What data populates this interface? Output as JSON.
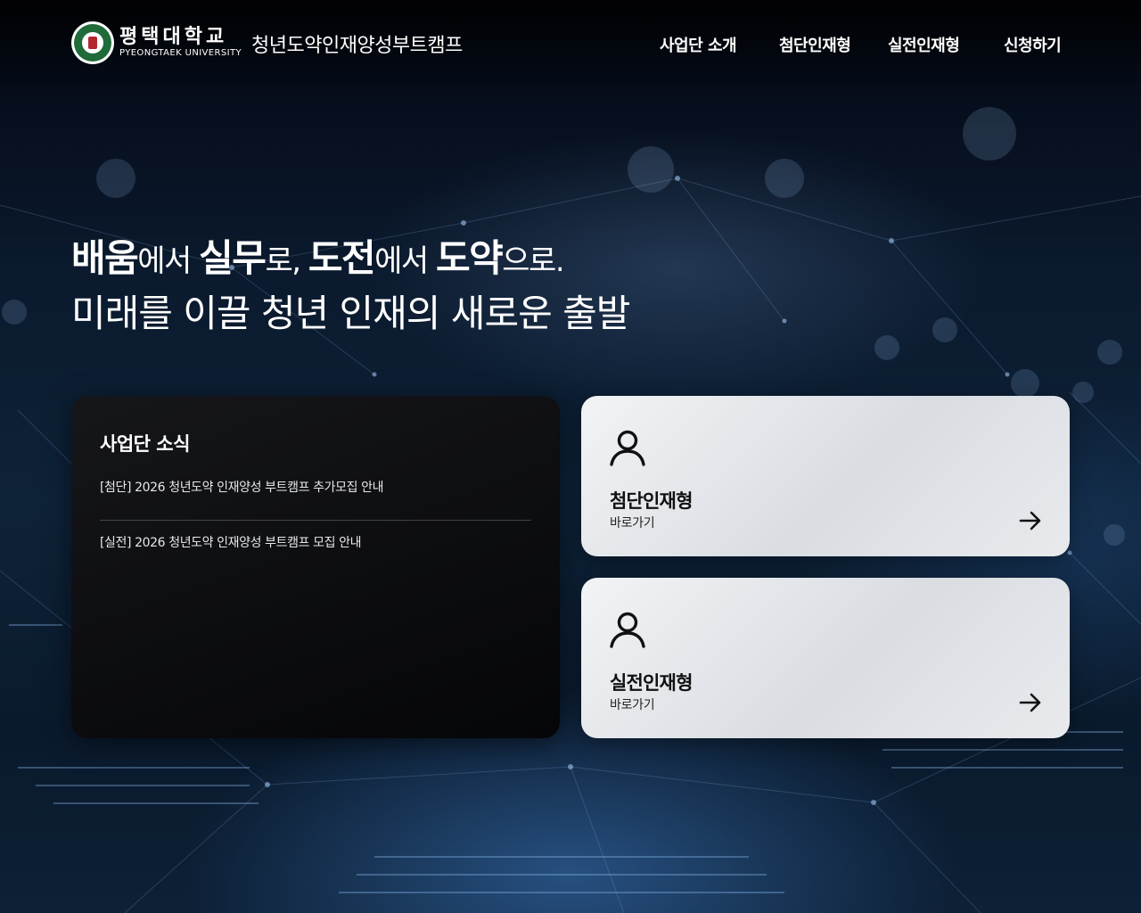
{
  "header": {
    "logo_ko": "평택대학교",
    "logo_en": "PYEONGTAEK UNIVERSITY",
    "site_title": "청년도약인재양성부트캠프",
    "nav": [
      {
        "label": "사업단 소개"
      },
      {
        "label": "첨단인재형"
      },
      {
        "label": "실전인재형"
      },
      {
        "label": "신청하기"
      }
    ]
  },
  "hero": {
    "line1": [
      {
        "text": "배움",
        "style": "b"
      },
      {
        "text": "에서 ",
        "style": "l"
      },
      {
        "text": "실무",
        "style": "b"
      },
      {
        "text": "로, ",
        "style": "l"
      },
      {
        "text": "도전",
        "style": "b"
      },
      {
        "text": "에서 ",
        "style": "l"
      },
      {
        "text": "도약",
        "style": "b"
      },
      {
        "text": "으로.",
        "style": "l"
      }
    ],
    "line2": "미래를 이끌 청년 인재의 새로운 출발"
  },
  "news": {
    "title": "사업단 소식",
    "items": [
      "[첨단] 2026 청년도약 인재양성 부트캠프 추가모집 안내",
      "[실전] 2026 청년도약 인재양성 부트캠프 모집 안내"
    ]
  },
  "cards": [
    {
      "title": "첨단인재형",
      "sub": "바로가기",
      "icon": "user-icon"
    },
    {
      "title": "실전인재형",
      "sub": "바로가기",
      "icon": "user-icon"
    }
  ],
  "colors": {
    "background": "#0b1a2e",
    "seal_green": "#1f6b3a",
    "card_bg": "#e4e6ea",
    "news_bg": "#0e0e10"
  }
}
